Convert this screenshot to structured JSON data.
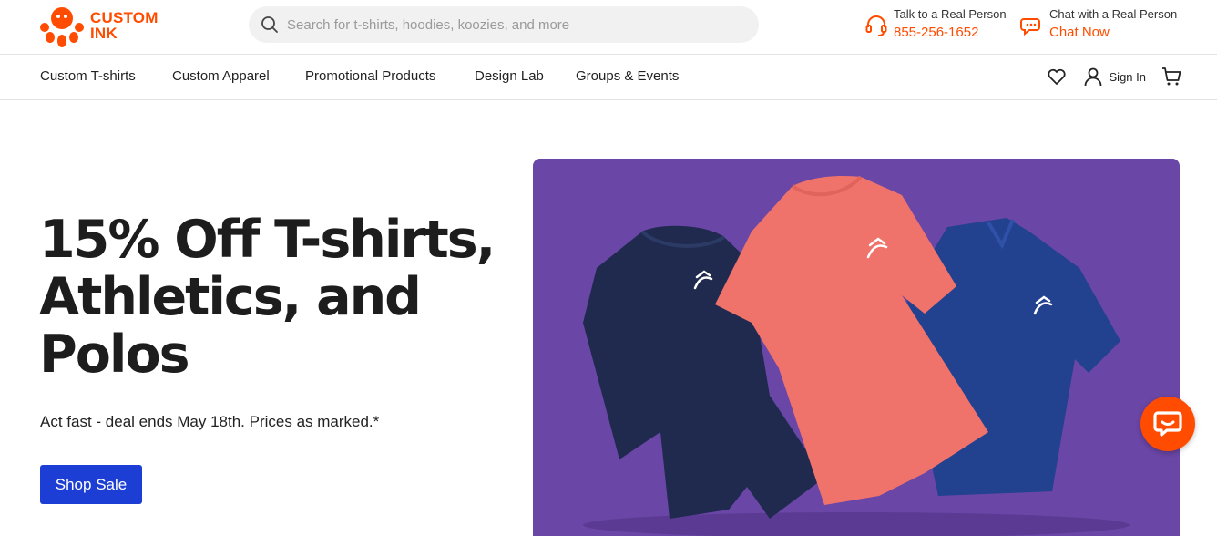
{
  "header": {
    "logo": {
      "line1": "CUSTOM",
      "line2": "INK"
    },
    "search": {
      "placeholder": "Search for t-shirts, hoodies, koozies, and more",
      "icon": "search-icon"
    },
    "phone": {
      "label": "Talk to a Real Person",
      "number": "855-256-1652",
      "icon": "headset-icon"
    },
    "chat": {
      "label": "Chat with a Real Person",
      "action": "Chat Now",
      "icon": "chat-icon"
    }
  },
  "nav": {
    "items": [
      {
        "label": "Custom T-shirts"
      },
      {
        "label": "Custom Apparel"
      },
      {
        "label": "Promotional Products"
      },
      {
        "label": "Design Lab"
      },
      {
        "label": "Groups & Events"
      }
    ],
    "signin_label": "Sign In",
    "icons": [
      "heart-icon",
      "user-icon",
      "cart-icon"
    ]
  },
  "hero": {
    "headline_lines": [
      "15% Off T-shirts,",
      "Athletics, and",
      "Polos"
    ],
    "subline": "Act fast - deal ends May 18th. Prices as marked.*",
    "cta_label": "Shop Sale",
    "image_alt": "Navy hoodie, coral t-shirt and blue polo on purple background"
  },
  "colors": {
    "brand": "#ff4c00",
    "cta": "#1d3ed4",
    "hero_bg": "#6a46a6",
    "shirt_navy": "#1f2a4e",
    "shirt_coral": "#f0736b",
    "shirt_blue": "#22418f"
  }
}
